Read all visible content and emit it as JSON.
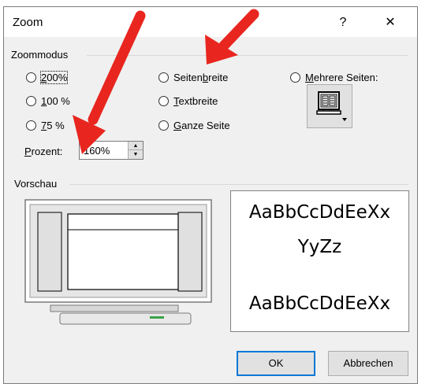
{
  "window": {
    "title": "Zoom",
    "help_label": "?",
    "close_label": "✕"
  },
  "zoommodus": {
    "label": "Zoommodus",
    "options_left": [
      {
        "id": "200",
        "label": "200%",
        "selected": false
      },
      {
        "id": "100",
        "label": "100 %",
        "selected": false
      },
      {
        "id": "75",
        "label": "75 %",
        "selected": false
      }
    ],
    "options_mid": [
      {
        "id": "seitenbreite",
        "label": "Seitenbreite",
        "selected": false
      },
      {
        "id": "textbreite",
        "label": "Textbreite",
        "selected": false
      },
      {
        "id": "ganze-seite",
        "label": "Ganze Seite",
        "selected": false
      }
    ],
    "mehrere_seiten": {
      "label": "Mehrere Seiten:",
      "selected": false
    },
    "prozent": {
      "label": "Prozent:",
      "value": "160%"
    }
  },
  "vorschau": {
    "label": "Vorschau",
    "sample_line1": "AaBbCcDdEeXx",
    "sample_line2": "YyZz",
    "sample_line3": "AaBbCcDdEeXx"
  },
  "buttons": {
    "ok": "OK",
    "cancel": "Abbrechen"
  },
  "colors": {
    "arrow": "#e8261f",
    "focus_border": "#0078d7",
    "dialog_bg": "#f0f0f0"
  },
  "icons": {
    "multipage": "monitor-pages-icon"
  }
}
